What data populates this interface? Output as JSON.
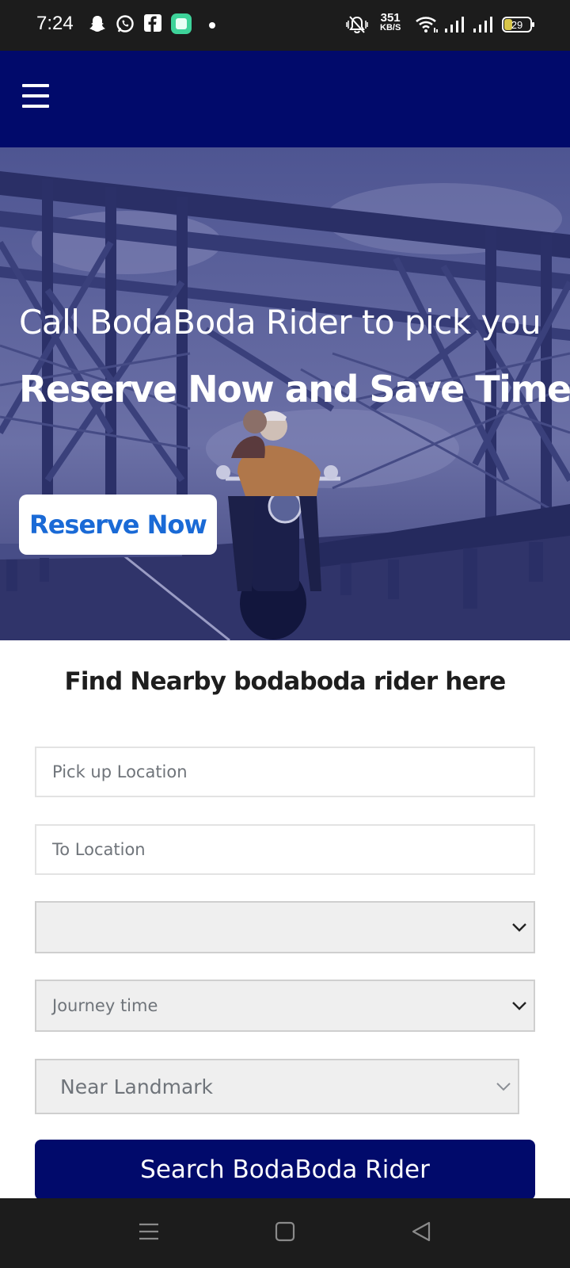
{
  "status_bar": {
    "time": "7:24",
    "network_speed_value": "351",
    "network_speed_unit": "KB/S",
    "battery": "29",
    "icons": [
      "snapchat-icon",
      "whatsapp-icon",
      "facebook-icon",
      "app-icon",
      "dot-icon",
      "mute-icon",
      "wifi-icon",
      "signal-icon",
      "signal-icon",
      "battery-icon"
    ]
  },
  "header": {
    "menu_icon": "hamburger-menu-icon",
    "background_color": "#010a6b"
  },
  "hero": {
    "subtitle": "Call BodaBoda Rider to pick you",
    "title": "Reserve Now and Save Time",
    "button_label": "Reserve Now",
    "button_text_color": "#1a6ad6"
  },
  "finder": {
    "title": "Find Nearby bodaboda rider here",
    "pickup_placeholder": "Pick up Location",
    "to_placeholder": "To Location",
    "select_empty_value": "",
    "journey_time_placeholder": "Journey time",
    "landmark_placeholder": "Near Landmark",
    "search_button_label": "Search BodaBoda Rider"
  },
  "nav_bar": {
    "buttons": [
      "menu-icon",
      "home-icon",
      "back-icon"
    ]
  }
}
